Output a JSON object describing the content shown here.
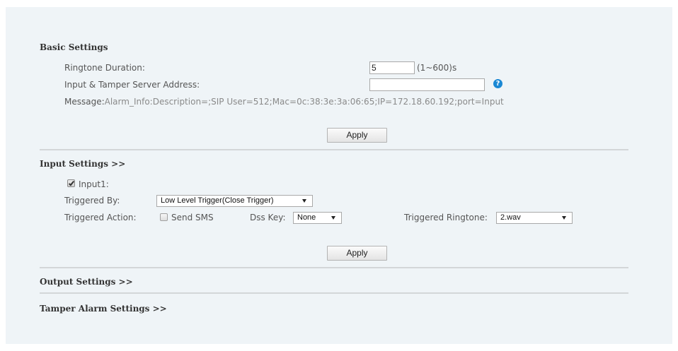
{
  "basic_settings": {
    "heading": "Basic Settings",
    "ringtone_duration": {
      "label": "Ringtone Duration:",
      "value": "5",
      "range": "(1~600)s"
    },
    "server_address": {
      "label": "Input & Tamper Server Address:",
      "value": "",
      "help_glyph": "?"
    },
    "message": {
      "label": "Message:",
      "value": "Alarm_Info:Description=;SIP User=512;Mac=0c:38:3e:3a:06:65;IP=172.18.60.192;port=Input"
    },
    "apply_label": "Apply"
  },
  "input_settings": {
    "heading": "Input Settings >>",
    "input1": {
      "label": "Input1:",
      "checked": true
    },
    "triggered_by": {
      "label": "Triggered By:",
      "selected": "Low Level Trigger(Close Trigger)"
    },
    "triggered_action": {
      "label": "Triggered Action:",
      "send_sms": {
        "label": "Send SMS",
        "checked": false
      }
    },
    "dss_key": {
      "label": "Dss Key:",
      "selected": "None"
    },
    "triggered_ringtone": {
      "label": "Triggered Ringtone:",
      "selected": "2.wav"
    },
    "apply_label": "Apply"
  },
  "output_settings": {
    "heading": "Output Settings >>"
  },
  "tamper_alarm_settings": {
    "heading": "Tamper Alarm Settings >>"
  },
  "icons": {
    "help": "help-icon",
    "dropdown": "chevron-down-icon",
    "checkbox": "checkbox-icon"
  },
  "colors": {
    "panel_background": "#eff4f7",
    "help_icon": "#1a88d4",
    "heading_text": "#333333",
    "label_text": "#555555",
    "message_text": "#8a8a8a",
    "divider": "#d3d6d8"
  }
}
